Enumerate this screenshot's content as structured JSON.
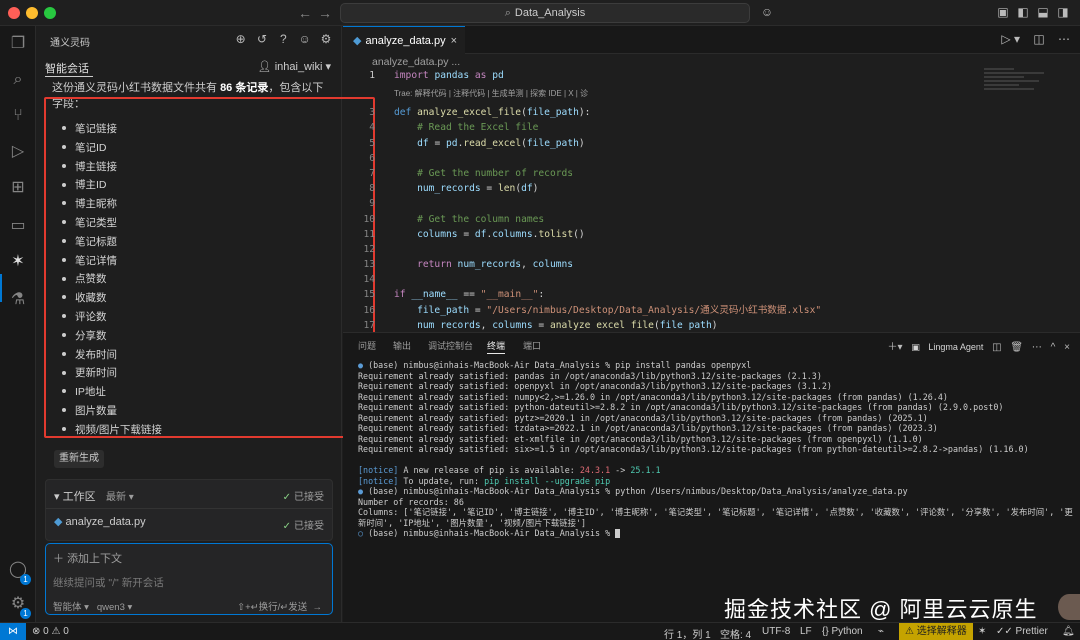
{
  "window": {
    "search_text": "Data_Analysis"
  },
  "chat": {
    "panel_title": "通义灵码",
    "tab_label": "智能会话",
    "user": "inhai_wiki",
    "message_prefix": "这份通义灵码小红书数据文件共有 ",
    "message_count": "86 条记录",
    "message_suffix": "，包含以下字段：",
    "fields": [
      "笔记链接",
      "笔记ID",
      "博主链接",
      "博主ID",
      "博主昵称",
      "笔记类型",
      "笔记标题",
      "笔记详情",
      "点赞数",
      "收藏数",
      "评论数",
      "分享数",
      "发布时间",
      "更新时间",
      "IP地址",
      "图片数量",
      "视频/图片下载链接"
    ],
    "regen_label": "重新生成",
    "workspace": {
      "title": "工作区",
      "filter": "最新",
      "status": "已接受",
      "file": "analyze_data.py",
      "file_status": "已接受"
    },
    "input": {
      "add_context": "添加上下文",
      "placeholder": "继续提问或 \"/\" 新开会话",
      "mode": "智能体",
      "model": "qwen3",
      "hint": "⇧+↵换行/↵发送"
    }
  },
  "editor": {
    "tab_label": "analyze_data.py",
    "breadcrumb": "analyze_data.py ...",
    "codelens": "Trae: 解释代码 | 注释代码 | 生成单测 | 探索 IDE | X | 诊"
  },
  "panel": {
    "tabs": [
      "问题",
      "输出",
      "调试控制台",
      "终端",
      "端口"
    ],
    "active_tab": "终端",
    "agent": "Lingma Agent",
    "terminal": {
      "line1": "(base) nimbus@inhais-MacBook-Air Data_Analysis % pip install pandas openpyxl",
      "req": [
        "Requirement already satisfied: pandas in /opt/anaconda3/lib/python3.12/site-packages (2.1.3)",
        "Requirement already satisfied: openpyxl in /opt/anaconda3/lib/python3.12/site-packages (3.1.2)",
        "Requirement already satisfied: numpy<2,>=1.26.0 in /opt/anaconda3/lib/python3.12/site-packages (from pandas) (1.26.4)",
        "Requirement already satisfied: python-dateutil>=2.8.2 in /opt/anaconda3/lib/python3.12/site-packages (from pandas) (2.9.0.post0)",
        "Requirement already satisfied: pytz>=2020.1 in /opt/anaconda3/lib/python3.12/site-packages (from pandas) (2025.1)",
        "Requirement already satisfied: tzdata>=2022.1 in /opt/anaconda3/lib/python3.12/site-packages (from pandas) (2023.3)",
        "Requirement already satisfied: et-xmlfile in /opt/anaconda3/lib/python3.12/site-packages (from openpyxl) (1.1.0)",
        "Requirement already satisfied: six>=1.5 in /opt/anaconda3/lib/python3.12/site-packages (from python-dateutil>=2.8.2->pandas) (1.16.0)"
      ],
      "notice1_text": " A new release of pip is available: ",
      "old_ver": "24.3.1",
      "arrow": " -> ",
      "new_ver": "25.1.1",
      "notice2_text": " To update, run: ",
      "notice2_cmd": "pip install --upgrade pip",
      "notice_tag": "[notice]",
      "run_cmd": "(base) nimbus@inhais-MacBook-Air Data_Analysis % python /Users/nimbus/Desktop/Data_Analysis/analyze_data.py",
      "out_records": "Number of records: 86",
      "out_columns": "Columns: ['笔记链接', '笔记ID', '博主链接', '博主ID', '博主昵称', '笔记类型', '笔记标题', '笔记详情', '点赞数', '收藏数', '评论数', '分享数', '发布时间', '更新时间', 'IP地址', '图片数量', '视频/图片下载链接']",
      "last_prompt": "(base) nimbus@inhais-MacBook-Air Data_Analysis % "
    }
  },
  "watermark": "掘金技术社区 @ 阿里云云原生",
  "status": {
    "errors": "0",
    "warnings": "0",
    "position": "行 1，列 1",
    "spaces": "空格: 4",
    "encoding": "UTF-8",
    "eol": "LF",
    "language": "Python",
    "interpreter": "选择解释器",
    "formatter": "Prettier"
  },
  "colors": {
    "accent": "#0078d4",
    "highlight_box": "#e23a2f",
    "warning_bar": "#c5a300"
  }
}
